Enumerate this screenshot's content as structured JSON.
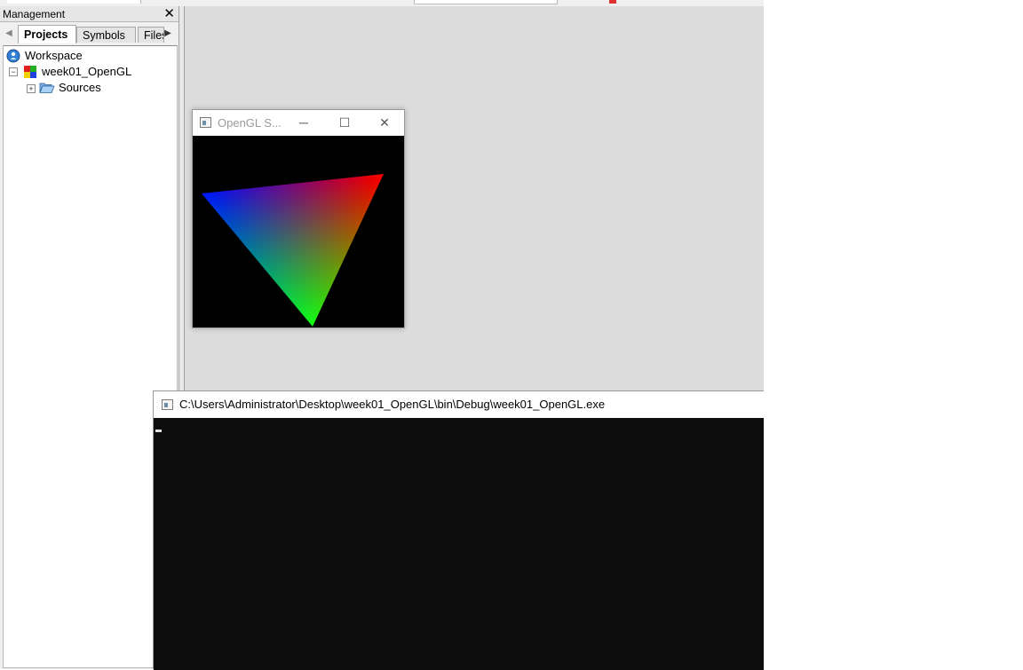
{
  "ide": {
    "management_panel": {
      "title": "Management",
      "close_glyph": "✕",
      "tabs": [
        {
          "label": "Projects",
          "active": true
        },
        {
          "label": "Symbols",
          "active": false
        },
        {
          "label": "Files",
          "active": false
        }
      ],
      "tab_scroll_left_glyph": "◀",
      "tab_scroll_right_glyph": "▶",
      "tree": {
        "workspace": {
          "label": "Workspace",
          "icon": "workspace-globe-icon"
        },
        "project": {
          "label": "week01_OpenGL",
          "icon": "project-blocks-icon",
          "expanded": true
        },
        "folders": [
          {
            "label": "Sources",
            "icon": "folder-open-icon",
            "expanded": false
          }
        ]
      }
    }
  },
  "opengl_window": {
    "title": "OpenGL S...",
    "buttons": {
      "minimize": "─",
      "maximize": "☐",
      "close": "✕"
    },
    "scene": {
      "shape": "triangle",
      "vertex_colors": {
        "red": "#ff0000",
        "green": "#00ff00",
        "blue": "#0000ff"
      },
      "background": "#000000"
    }
  },
  "console_window": {
    "title": "C:\\Users\\Administrator\\Desktop\\week01_OpenGL\\bin\\Debug\\week01_OpenGL.exe",
    "background": "#0c0c0c"
  },
  "colors": {
    "editor_background": "#dcdcdc",
    "panel_background": "#f0f0f0"
  }
}
